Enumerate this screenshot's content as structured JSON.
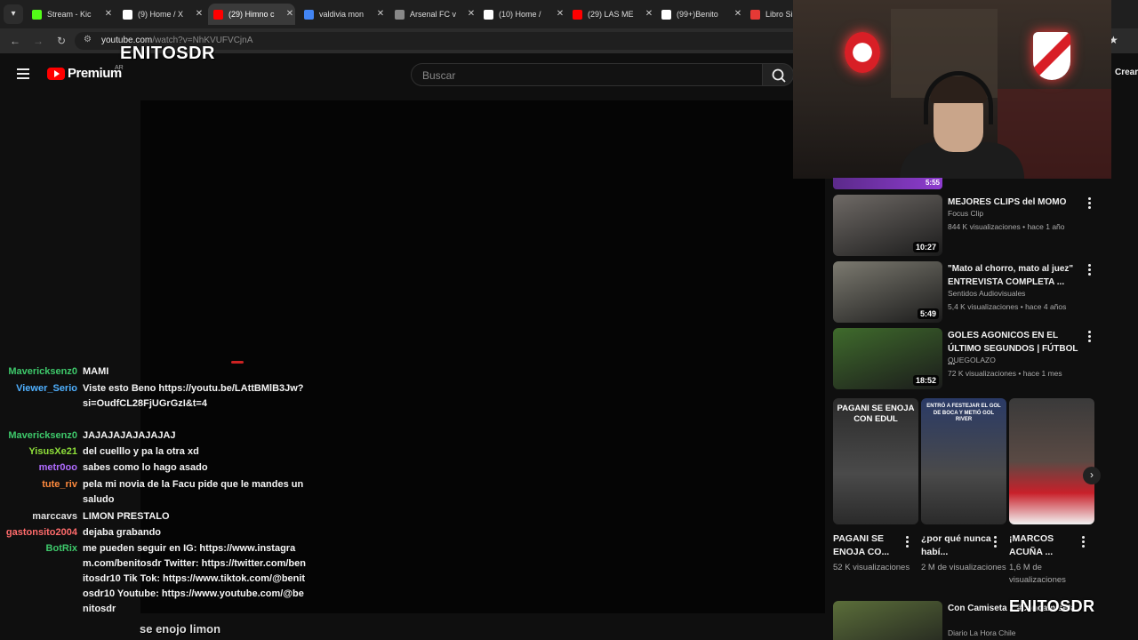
{
  "browser": {
    "tabs": [
      {
        "label": "Stream - Kic",
        "fav": "#53fc18",
        "active": false
      },
      {
        "label": "(9) Home / X",
        "fav": "#ffffff",
        "active": false
      },
      {
        "label": "(29) Himno c",
        "fav": "#ff0000",
        "active": true
      },
      {
        "label": "valdivia mon",
        "fav": "#4285f4",
        "active": false
      },
      {
        "label": "Arsenal FC v",
        "fav": "#888888",
        "active": false
      },
      {
        "label": "(10) Home /",
        "fav": "#ffffff",
        "active": false
      },
      {
        "label": "(29) LAS ME",
        "fav": "#ff0000",
        "active": false
      },
      {
        "label": "(99+)Benito",
        "fav": "#ffffff",
        "active": false
      },
      {
        "label": "Libro Sin",
        "fav": "#e53935",
        "active": false
      }
    ],
    "url_host": "youtube.com",
    "url_path": "/watch?v=NhKVUFVCjnA"
  },
  "youtube": {
    "brand": "Premium",
    "country": "AR",
    "search_placeholder": "Buscar",
    "create_label": "Crear"
  },
  "overlay": {
    "watermark_top": "ENITOSDR",
    "watermark_bottom": "ENITOSDR",
    "subtitle": "se enojo limon"
  },
  "recommendations": [
    {
      "title": "MEJORES CLIPS del MOMO",
      "channel": "Focus Clip",
      "meta": "844 K visualizaciones • hace 1 año",
      "duration": "10:27",
      "thumb": "#6f6a66"
    },
    {
      "title": "\"Mato al chorro, mato al juez\" ENTREVISTA COMPLETA ...",
      "channel": "Sentidos Audiovisuales",
      "meta": "5,4 K visualizaciones • hace 4 años",
      "duration": "5:49",
      "thumb": "#7c7a70"
    },
    {
      "title": "GOLES AGONICOS EN EL ÚLTIMO SEGUNDOS | FÚTBOL ...",
      "channel": "QUEGOLAZO",
      "meta": "72 K visualizaciones • hace 1 mes",
      "duration": "18:52",
      "thumb": "#3f6b2c"
    },
    {
      "title": "Con Camiseta 2 #concamiseta",
      "channel": "Diario La Hora Chile",
      "meta": "",
      "duration": "",
      "thumb": "#5b6e3a"
    }
  ],
  "top_strip_duration": "5:55",
  "shorts": [
    {
      "title": "PAGANI SE ENOJA CO...",
      "views": "52 K visualizaciones",
      "overlay_text": "PAGANI SE ENOJA CON EDUL",
      "thumb": "#2b2b2b"
    },
    {
      "title": "¿por qué nunca habí...",
      "views": "2 M de visualizaciones",
      "overlay_text": "ENTRÓ A FESTEJAR EL GOL DE BOCA Y METIÓ GOL RIVER",
      "thumb": "#2a3a66"
    },
    {
      "title": "¡MARCOS ACUÑA ...",
      "views": "1,6 M de visualizaciones",
      "overlay_text": "",
      "thumb": "#d33"
    }
  ],
  "chat": [
    {
      "user": "Mavericksenz0",
      "color": "#3ec96b",
      "text": "MAMI"
    },
    {
      "user": "Viewer_Serio",
      "color": "#4fb0ff",
      "text": "Viste esto Beno https://youtu.be/LAttBMlB3Jw?si=OudfCL28FjUGrGzI&t=4"
    },
    {
      "user": "Mavericksenz0",
      "color": "#3ec96b",
      "text": "JAJAJAJAJAJAJAJ"
    },
    {
      "user": "YisusXe21",
      "color": "#8fe03a",
      "text": "del cuelllo y pa la otra xd"
    },
    {
      "user": "metr0oo",
      "color": "#b06cff",
      "text": "sabes como lo hago asado"
    },
    {
      "user": "tute_riv",
      "color": "#ff8a3d",
      "text": "pela mi novia de la Facu pide que le mandes un saludo"
    },
    {
      "user": "marccavs",
      "color": "#e0e0e0",
      "text": "LIMON PRESTALO"
    },
    {
      "user": "gastonsito2004",
      "color": "#ff6b6b",
      "text": "dejaba grabando"
    },
    {
      "user": "BotRix",
      "color": "#3ec96b",
      "text": "me pueden seguir en IG: https://www.instagram.com/benitosdr Twitter: https://twitter.com/benitosdr10 Tik Tok: https://www.tiktok.com/@benitosdr10 Youtube: https://www.youtube.com/@benitosdr"
    }
  ],
  "icons": {
    "menu": "hamburger-icon",
    "search": "search-icon",
    "more": "kebab-icon",
    "next": "chevron-right-icon"
  }
}
